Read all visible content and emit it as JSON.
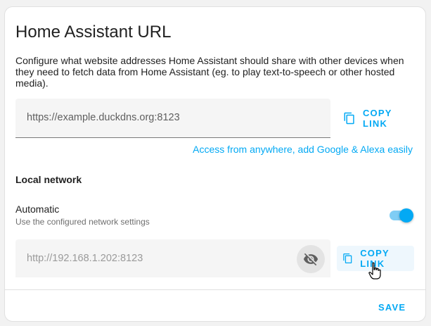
{
  "dialog": {
    "title": "Home Assistant URL",
    "description": "Configure what website addresses Home Assistant should share with other devices when they need to fetch data from Home Assistant (eg. to play text-to-speech or other hosted media)."
  },
  "external": {
    "url": "https://example.duckdns.org:8123",
    "copy_label": "COPY LINK",
    "cloud_link": "Access from anywhere, add Google & Alexa easily"
  },
  "local": {
    "section_title": "Local network",
    "automatic_label": "Automatic",
    "automatic_description": "Use the configured network settings",
    "automatic_enabled": true,
    "url": "http://192.168.1.202:8123",
    "copy_label": "COPY LINK"
  },
  "footer": {
    "save_label": "SAVE"
  },
  "colors": {
    "accent": "#03a9f4",
    "text": "#212121",
    "secondary_text": "#6f6f6f"
  },
  "icons": [
    "copy-icon",
    "eye-off-icon",
    "hand-cursor-icon"
  ]
}
